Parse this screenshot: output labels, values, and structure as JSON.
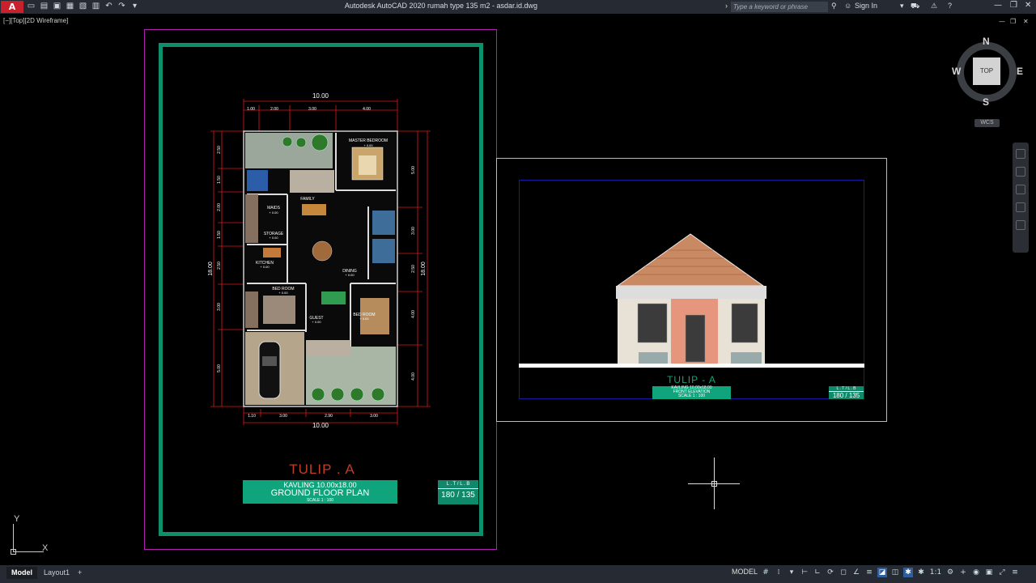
{
  "app": {
    "title": "Autodesk AutoCAD 2020   rumah type 135 m2 - asdar.id.dwg",
    "logo": "A",
    "search_placeholder": "Type a keyword or phrase",
    "sign_in": "Sign In",
    "viewport_label": "[−][Top][2D Wireframe]"
  },
  "qat_icons": [
    "new-icon",
    "open-icon",
    "save-icon",
    "saveas-icon",
    "web-icon",
    "print-icon",
    "undo-icon",
    "redo-icon",
    "dropdown-icon"
  ],
  "floor_plan": {
    "dim_top_total": "10.00",
    "dim_top": [
      "1.00",
      "2.00",
      "3.00",
      "4.00"
    ],
    "dim_bottom_total": "10.00",
    "dim_bottom": [
      "1.10",
      "3.00",
      "2.90",
      "3.00"
    ],
    "dim_left_total": "18.00",
    "dim_left": [
      "2.50",
      "1.50",
      "2.00",
      "1.50",
      "2.50",
      "3.00",
      "5.00"
    ],
    "dim_right_total": "18.00",
    "dim_right": [
      "5.00",
      "3.00",
      "2.50",
      "4.00",
      "4.00"
    ],
    "rooms": [
      {
        "name": "MASTER BEDROOM",
        "level": "+ 0.00"
      },
      {
        "name": "FAMILY",
        "level": ""
      },
      {
        "name": "MAIDS",
        "level": "+ 0.00"
      },
      {
        "name": "STORAGE",
        "level": "+ 0.00"
      },
      {
        "name": "KITCHEN",
        "level": "+ 0.00"
      },
      {
        "name": "DINING",
        "level": "+ 0.00"
      },
      {
        "name": "BED ROOM",
        "level": "+ 0.00"
      },
      {
        "name": "GUEST",
        "level": "+ 0.00"
      },
      {
        "name": "BED ROOM",
        "level": "+ 0.00"
      }
    ],
    "title": "TULIP . A",
    "kavling": "KAVLING 10.00x18.00",
    "plan_name": "GROUND FLOOR PLAN",
    "scale": "SCALE  1 : 100",
    "lt_label": "L . T / L . B",
    "lt_value": "180 / 135"
  },
  "elevation": {
    "title": "TULIP - A",
    "kavling": "KAVLING 10.00x18.00",
    "name": "FRONT ELEVATION",
    "scale": "SCALE  1 : 100",
    "lt_label": "L . T / L . B",
    "lt_value": "180 / 135"
  },
  "viewcube": {
    "n": "N",
    "s": "S",
    "e": "E",
    "w": "W",
    "face": "TOP",
    "wcs": "WCS"
  },
  "ucs": {
    "x": "X",
    "y": "Y"
  },
  "status": {
    "tabs": [
      "Model",
      "Layout1"
    ],
    "add_tab": "+",
    "model_label": "MODEL",
    "scale": "1:1",
    "icons": [
      "grid-icon",
      "snap-icon",
      "dropdown-icon",
      "infer-icon",
      "ortho-icon",
      "polar-icon",
      "osnap-icon",
      "otrack-icon",
      "lineweight-icon",
      "transparency-icon",
      "selection-cycling-icon",
      "annotation-icon",
      "annotation-scale-icon",
      "workspace-icon",
      "plus-icon",
      "isolate-icon",
      "hardware-icon",
      "fullscreen-icon",
      "customize-icon"
    ]
  },
  "colors": {
    "accent_green": "#10a47d",
    "frame_green": "#0e8f6c",
    "title_red": "#c23c2a",
    "magenta": "#b020b0"
  }
}
